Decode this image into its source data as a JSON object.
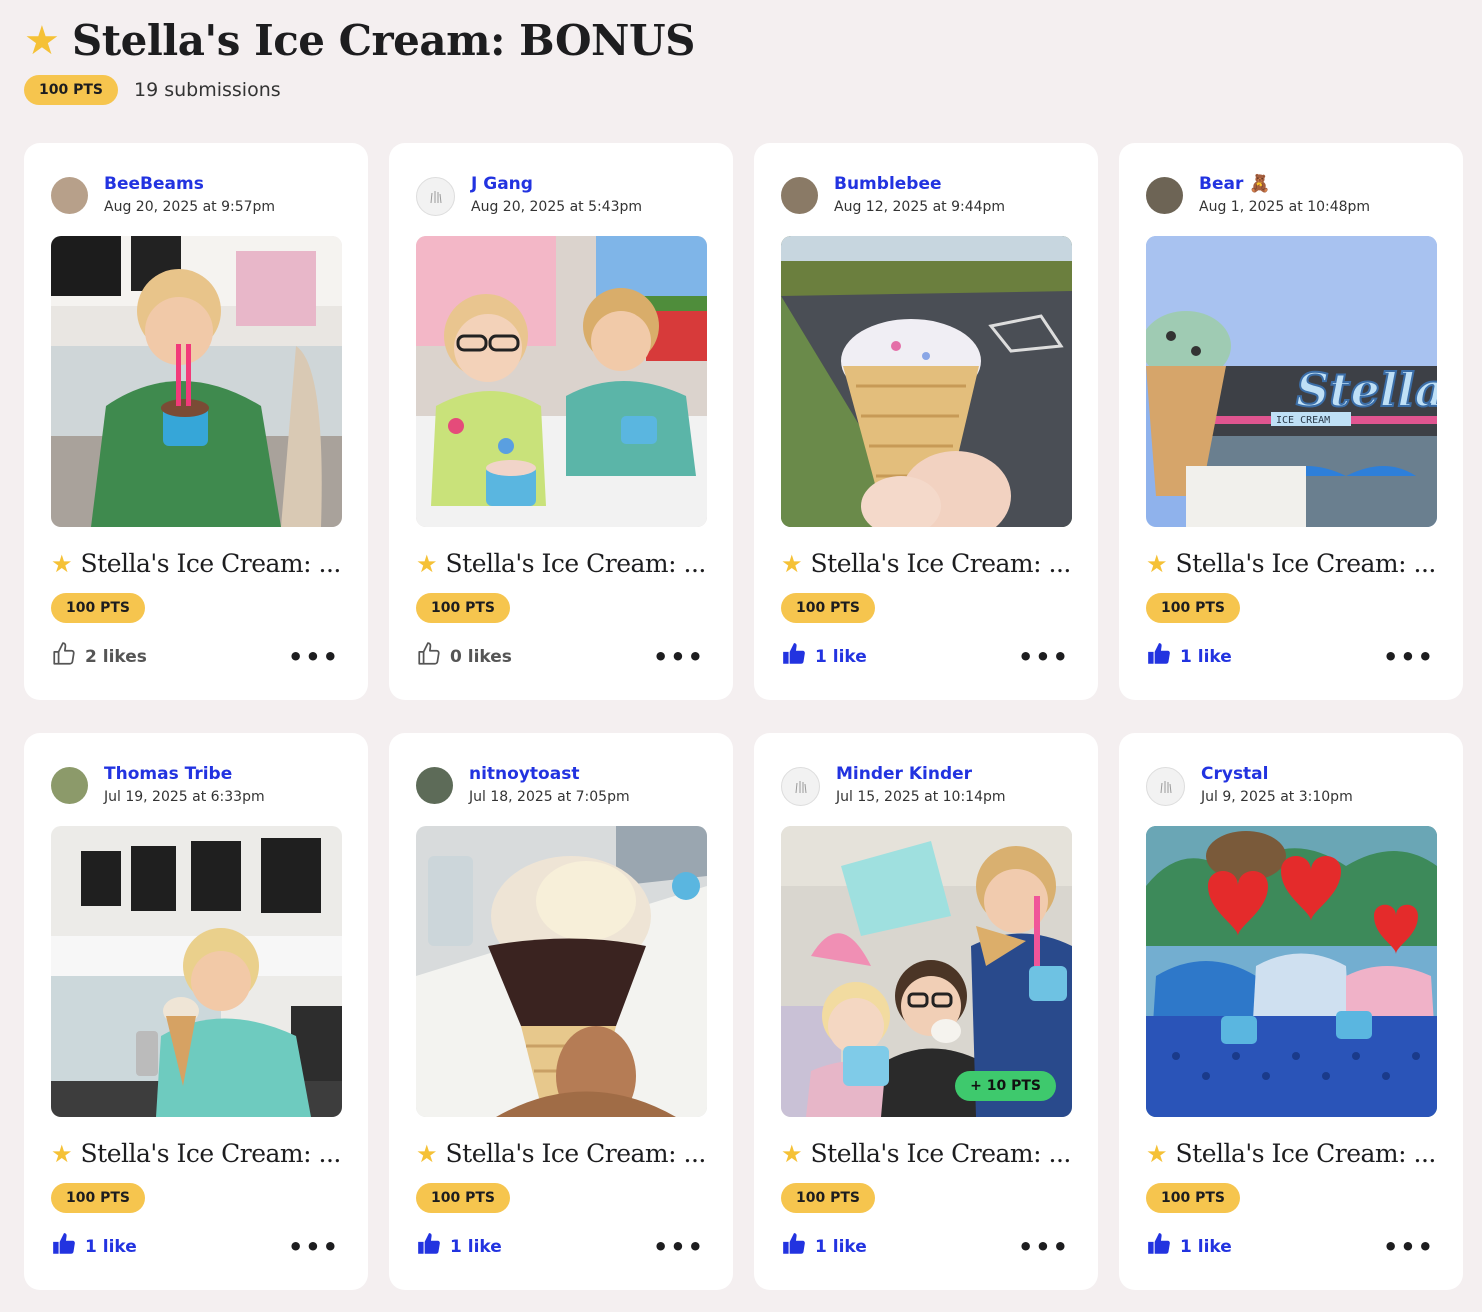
{
  "page": {
    "title_icon": "star-icon",
    "title": "Stella's Ice Cream: BONUS",
    "points": "100 PTS",
    "submissions": "19 submissions"
  },
  "cards": [
    {
      "user": "BeeBeams",
      "date": "Aug 20, 2025 at 9:57pm",
      "title": "Stella's Ice Cream: ...",
      "points": "100 PTS",
      "likes": "2 likes",
      "liked": false,
      "avatar_color": "#b7a08a",
      "photo_theme": "boy-shop",
      "bonus": null
    },
    {
      "user": "J Gang",
      "date": "Aug 20, 2025 at 5:43pm",
      "title": "Stella's Ice Cream: ...",
      "points": "100 PTS",
      "likes": "0 likes",
      "liked": false,
      "avatar_color": "#f2f2f2",
      "photo_theme": "kids-table",
      "bonus": null
    },
    {
      "user": "Bumblebee",
      "date": "Aug 12, 2025 at 9:44pm",
      "title": "Stella's Ice Cream: ...",
      "points": "100 PTS",
      "likes": "1 like",
      "liked": true,
      "avatar_color": "#8a7a66",
      "photo_theme": "cone-parking",
      "bonus": null
    },
    {
      "user": "Bear 🧸",
      "date": "Aug 1, 2025 at 10:48pm",
      "title": "Stella's Ice Cream: ...",
      "points": "100 PTS",
      "likes": "1 like",
      "liked": true,
      "avatar_color": "#6d6455",
      "photo_theme": "storefront",
      "bonus": null,
      "sign_text": "Stella's",
      "sign_sub": "ICE CREAM"
    },
    {
      "user": "Thomas Tribe",
      "date": "Jul 19, 2025 at 6:33pm",
      "title": "Stella's Ice Cream: ...",
      "points": "100 PTS",
      "likes": "1 like",
      "liked": true,
      "avatar_color": "#8c9a6a",
      "photo_theme": "boy-counter",
      "bonus": null
    },
    {
      "user": "nitnoytoast",
      "date": "Jul 18, 2025 at 7:05pm",
      "title": "Stella's Ice Cream: ...",
      "points": "100 PTS",
      "likes": "1 like",
      "liked": true,
      "avatar_color": "#5d6b58",
      "photo_theme": "dipped-cone",
      "bonus": null
    },
    {
      "user": "Minder Kinder",
      "date": "Jul 15, 2025 at 10:14pm",
      "title": "Stella's Ice Cream: ...",
      "points": "100 PTS",
      "likes": "1 like",
      "liked": true,
      "avatar_color": "#f2f2f2",
      "photo_theme": "family-selfie",
      "bonus": "+ 10 PTS"
    },
    {
      "user": "Crystal",
      "date": "Jul 9, 2025 at 3:10pm",
      "title": "Stella's Ice Cream: ...",
      "points": "100 PTS",
      "likes": "1 like",
      "liked": true,
      "avatar_color": "#f2f2f2",
      "photo_theme": "kids-hearts",
      "bonus": null
    }
  ]
}
